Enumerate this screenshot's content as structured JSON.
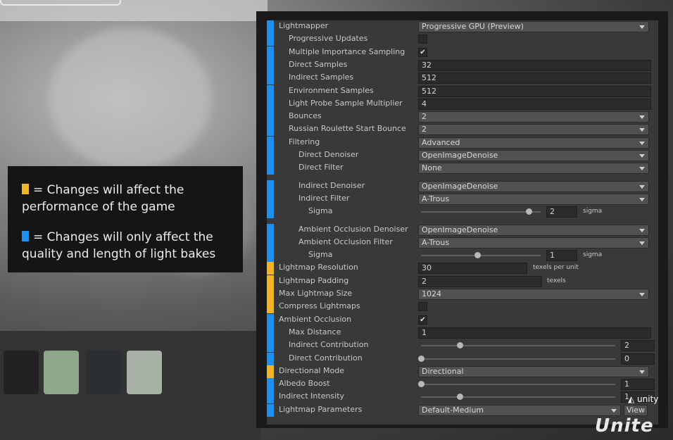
{
  "colors": {
    "performance": "#f0b528",
    "quality": "#1f8ff0",
    "panel": "#393939"
  },
  "legend": {
    "performance_text": "= Changes will affect the performance of the game",
    "quality_text": "= Changes will only affect the quality and length of light bakes"
  },
  "inspector": {
    "rows": [
      {
        "label": "Lightmapper",
        "indent": 0,
        "bar": "quality",
        "type": "dropdown",
        "value": "Progressive GPU (Preview)"
      },
      {
        "label": "Progressive Updates",
        "indent": 1,
        "bar": "quality",
        "type": "checkbox",
        "checked": false
      },
      {
        "label": "Multiple Importance Sampling",
        "indent": 1,
        "bar": "quality",
        "type": "checkbox",
        "checked": true
      },
      {
        "label": "Direct Samples",
        "indent": 1,
        "bar": "quality",
        "type": "field",
        "value": "32"
      },
      {
        "label": "Indirect Samples",
        "indent": 1,
        "bar": "quality",
        "type": "field",
        "value": "512"
      },
      {
        "label": "Environment Samples",
        "indent": 1,
        "bar": "quality",
        "type": "field",
        "value": "512"
      },
      {
        "label": "Light Probe Sample Multiplier",
        "indent": 1,
        "bar": "quality",
        "type": "field",
        "value": "4"
      },
      {
        "label": "Bounces",
        "indent": 1,
        "bar": "quality",
        "type": "dropdown",
        "value": "2"
      },
      {
        "label": "Russian Roulette Start Bounce",
        "indent": 1,
        "bar": "quality",
        "type": "dropdown",
        "value": "2"
      },
      {
        "label": "Filtering",
        "indent": 1,
        "bar": "quality",
        "type": "dropdown",
        "value": "Advanced"
      },
      {
        "label": "Direct Denoiser",
        "indent": 2,
        "bar": "quality",
        "type": "dropdown",
        "value": "OpenImageDenoise"
      },
      {
        "label": "Direct Filter",
        "indent": 2,
        "bar": "quality",
        "type": "dropdown",
        "value": "None"
      },
      {
        "label": "Indirect Denoiser",
        "indent": 2,
        "bar": "quality",
        "type": "dropdown",
        "value": "OpenImageDenoise",
        "gap": true
      },
      {
        "label": "Indirect Filter",
        "indent": 2,
        "bar": "quality",
        "type": "dropdown",
        "value": "A-Trous"
      },
      {
        "label": "Sigma",
        "indent": 3,
        "bar": "quality",
        "type": "slider",
        "value": "2",
        "unit": "sigma",
        "level": 0.9
      },
      {
        "label": "Ambient Occlusion Denoiser",
        "indent": 2,
        "bar": "quality",
        "type": "dropdown",
        "value": "OpenImageDenoise",
        "gap": true
      },
      {
        "label": "Ambient Occlusion Filter",
        "indent": 2,
        "bar": "quality",
        "type": "dropdown",
        "value": "A-Trous"
      },
      {
        "label": "Sigma",
        "indent": 3,
        "bar": "quality",
        "type": "slider",
        "value": "1",
        "unit": "sigma",
        "level": 0.47
      },
      {
        "label": "Lightmap Resolution",
        "indent": 0,
        "bar": "performance",
        "type": "field",
        "value": "30",
        "unit": "texels per unit"
      },
      {
        "label": "Lightmap Padding",
        "indent": 0,
        "bar": "performance",
        "type": "field",
        "value": "2",
        "unit": "texels"
      },
      {
        "label": "Max Lightmap Size",
        "indent": 0,
        "bar": "performance",
        "type": "dropdown",
        "value": "1024"
      },
      {
        "label": "Compress Lightmaps",
        "indent": 0,
        "bar": "performance",
        "type": "checkbox",
        "checked": false
      },
      {
        "label": "Ambient Occlusion",
        "indent": 0,
        "bar": "quality",
        "type": "checkbox",
        "checked": true
      },
      {
        "label": "Max Distance",
        "indent": 1,
        "bar": "quality",
        "type": "field",
        "value": "1"
      },
      {
        "label": "Indirect Contribution",
        "indent": 1,
        "bar": "quality",
        "type": "slider",
        "value": "2",
        "level": 0.2
      },
      {
        "label": "Direct Contribution",
        "indent": 1,
        "bar": "quality",
        "type": "slider",
        "value": "0",
        "level": 0.0
      },
      {
        "label": "Directional Mode",
        "indent": 0,
        "bar": "performance",
        "type": "dropdown",
        "value": "Directional"
      },
      {
        "label": "Albedo Boost",
        "indent": 0,
        "bar": "quality",
        "type": "slider",
        "value": "1",
        "level": 0.0
      },
      {
        "label": "Indirect Intensity",
        "indent": 0,
        "bar": "quality",
        "type": "slider",
        "value": "1",
        "level": 0.2
      },
      {
        "label": "Lightmap Parameters",
        "indent": 0,
        "bar": "quality",
        "type": "dropdown-view",
        "value": "Default-Medium",
        "button": "View"
      }
    ]
  },
  "branding": {
    "unity": "unity",
    "unite": "Unite"
  }
}
